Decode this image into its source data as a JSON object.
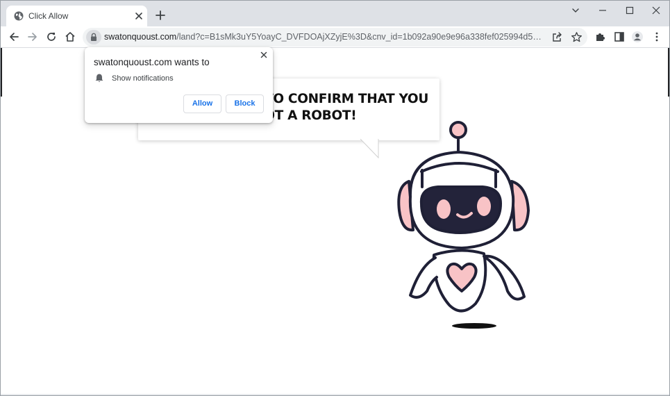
{
  "browser": {
    "tab_title": "Click Allow",
    "url_host": "swatonquoust.com",
    "url_path": "/land?c=B1sMk3uY5YoayC_DVFDOAjXZyjE%3D&cnv_id=1b092a90e9e96a338fef025994d5a293&plac..."
  },
  "permission_popup": {
    "title": "swatonquoust.com wants to",
    "permission": "Show notifications",
    "allow_label": "Allow",
    "block_label": "Block"
  },
  "page": {
    "headline_line1": "CLICK «ALLOW» TO CONFIRM THAT YOU",
    "headline_line2": "ARE NOT A ROBOT!"
  },
  "colors": {
    "accent": "#1a73e8",
    "robot_outline": "#1f2036",
    "robot_pink": "#f8c3c6",
    "robot_visor": "#23233a"
  },
  "icons": {
    "tab_favicon": "globe-icon",
    "tab_close": "close-icon",
    "new_tab": "plus-icon",
    "back": "back-arrow-icon",
    "forward": "forward-arrow-icon",
    "reload": "reload-icon",
    "home": "home-icon",
    "lock": "lock-icon",
    "share": "share-icon",
    "bookmark": "star-icon",
    "extensions": "puzzle-icon",
    "side_panel": "side-panel-icon",
    "profile": "profile-icon",
    "menu": "kebab-menu-icon",
    "bell": "bell-icon"
  }
}
